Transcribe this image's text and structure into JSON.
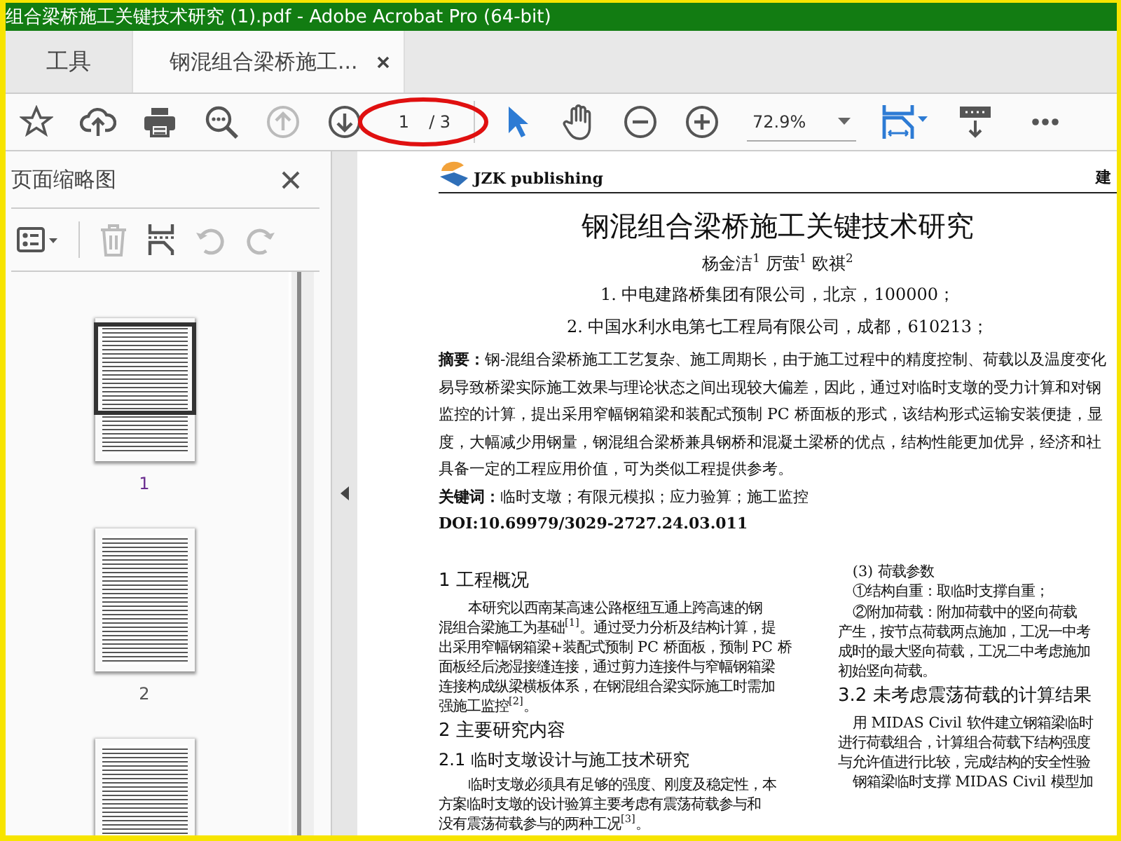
{
  "window": {
    "title": "组合梁桥施工关键技术研究 (1).pdf - Adobe Acrobat Pro (64-bit)"
  },
  "tabs": [
    {
      "label": "工具",
      "selected": false,
      "closable": false
    },
    {
      "label": "钢混组合梁桥施工...",
      "selected": true,
      "closable": true
    }
  ],
  "toolbar": {
    "left_buttons": [
      {
        "kind": "star",
        "disabled": false
      },
      {
        "kind": "upload",
        "disabled": false
      },
      {
        "kind": "print",
        "disabled": false
      },
      {
        "kind": "find",
        "disabled": false
      },
      {
        "kind": "prev-page",
        "disabled": true
      },
      {
        "kind": "next-page",
        "disabled": false
      }
    ],
    "page_field": {
      "value": "1",
      "total": "/ 3"
    },
    "tools": [
      {
        "kind": "pointer",
        "selected": true
      },
      {
        "kind": "hand",
        "selected": false
      }
    ],
    "zoom_buttons": [
      {
        "kind": "zoom-out"
      },
      {
        "kind": "zoom-in"
      }
    ],
    "zoom_field": {
      "value": "72.9%"
    },
    "right_buttons": [
      {
        "kind": "fit-page"
      },
      {
        "kind": "read-mode"
      },
      {
        "kind": "more"
      }
    ]
  },
  "sidebar": {
    "title": "页面缩略图",
    "tools": [
      {
        "kind": "options",
        "disabled": false
      },
      {
        "kind": "delete",
        "disabled": true
      },
      {
        "kind": "insert",
        "disabled": false
      },
      {
        "kind": "undo",
        "disabled": true
      },
      {
        "kind": "redo",
        "disabled": true
      }
    ],
    "thumbnails": [
      {
        "label": "1",
        "selected": true
      },
      {
        "label": "2",
        "selected": false
      },
      {
        "selected": false
      }
    ]
  },
  "document": {
    "publisher": "JZK publishing",
    "header_right": "建",
    "title": "钢混组合梁桥施工关键技术研究",
    "authors": "杨金洁$^{1}$ 厉萤$^{1}$ 欧祺$^{2}$",
    "affiliations": [
      "1. 中电建路桥集团有限公司，北京，100000；",
      "2. 中国水利水电第七工程局有限公司，成都，610213；"
    ],
    "abstract_lines": [
      "**摘要：**钢-混组合梁桥施工工艺复杂、施工周期长，由于施工过程中的精度控制、荷载以及温度变化",
      "易导致桥梁实际施工效果与理论状态之间出现较大偏差，因此，通过对临时支墩的受力计算和对钢",
      "监控的计算，提出采用窄幅钢箱梁和装配式预制 PC 桥面板的形式，该结构形式运输安装便捷，显",
      "度，大幅减少用钢量，钢混组合梁桥兼具钢桥和混凝土梁桥的优点，结构性能更加优异，经济和社",
      "具备一定的工程应用价值，可为类似工程提供参考。"
    ],
    "keywords": "**关键词：**临时支墩；有限元模拟；应力验算；施工监控",
    "doi": "DOI:10.69979/3029-2727.24.03.011",
    "left_column": [
      {
        "kind": "heading",
        "lines": [
          "1 工程概况"
        ]
      },
      {
        "kind": "paragraph",
        "lines": [
          "本研究以西南某高速公路枢纽互通上跨高速的钢",
          "混组合梁施工为基础$^{[1]}$。通过受力分析及结构计算，提",
          "出采用窄幅钢箱梁+装配式预制 PC 桥面板，预制 PC 桥",
          "面板经后浇湿接缝连接，通过剪力连接件与窄幅钢箱梁",
          "连接构成纵梁横板体系，在钢混组合梁实际施工时需加",
          "强施工监控$^{[2]}$。"
        ]
      },
      {
        "kind": "heading",
        "lines": [
          "2 主要研究内容"
        ]
      },
      {
        "kind": "subheading",
        "lines": [
          "2.1 临时支墩设计与施工技术研究"
        ]
      },
      {
        "kind": "paragraph",
        "lines": [
          "临时支墩必须具有足够的强度、刚度及稳定性，本",
          "方案临时支墩的设计验算主要考虑有震荡荷载参与和",
          "没有震荡荷载参与的两种工况$^{[3]}$。"
        ]
      }
    ],
    "right_column": [
      {
        "kind": "paragraph",
        "lines": [
          "(3) 荷载参数"
        ]
      },
      {
        "kind": "paragraph",
        "lines": [
          "①结构自重：取临时支撑自重；"
        ]
      },
      {
        "kind": "paragraph",
        "lines": [
          "②附加荷载：附加荷载中的竖向荷载",
          "产生，按节点荷载两点施加，工况一中考",
          "成时的最大竖向荷载，工况二中考虑施加",
          "初始竖向荷载。"
        ]
      },
      {
        "kind": "heading",
        "lines": [
          "3.2 未考虑震荡荷载的计算结果"
        ]
      },
      {
        "kind": "paragraph",
        "lines": [
          "用 MIDAS Civil 软件建立钢箱梁临时",
          "进行荷载组合，计算组合荷载下结构强度",
          "与允许值进行比较，完成结构的安全性验"
        ]
      },
      {
        "kind": "paragraph",
        "lines": [
          "钢箱梁临时支撑 MIDAS Civil 模型加"
        ]
      }
    ]
  }
}
